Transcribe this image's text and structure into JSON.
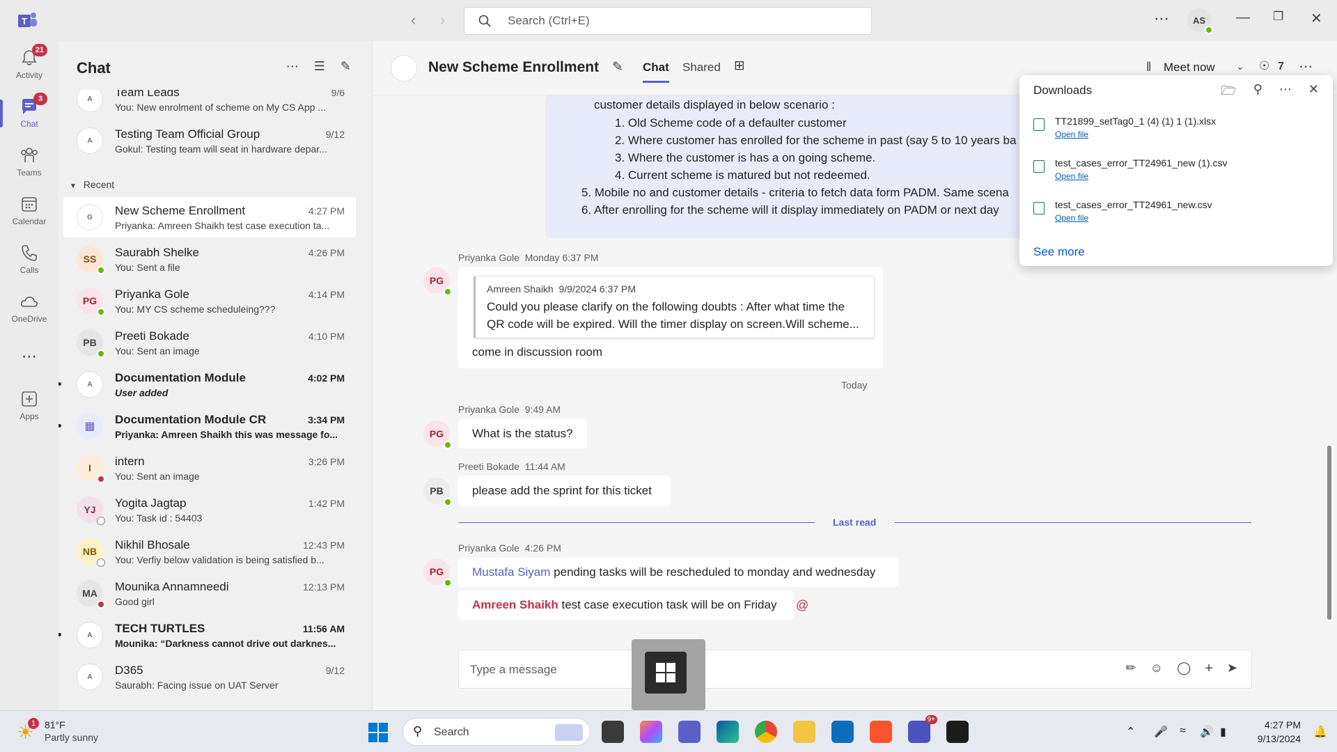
{
  "titlebar": {
    "search_placeholder": "Search (Ctrl+E)",
    "user_initials": "AS"
  },
  "rail": [
    {
      "label": "Activity",
      "badge": "21"
    },
    {
      "label": "Chat",
      "badge": "3"
    },
    {
      "label": "Teams",
      "badge": ""
    },
    {
      "label": "Calendar",
      "badge": ""
    },
    {
      "label": "Calls",
      "badge": ""
    },
    {
      "label": "OneDrive",
      "badge": ""
    },
    {
      "label": "",
      "badge": ""
    },
    {
      "label": "Apps",
      "badge": ""
    }
  ],
  "chatlist": {
    "title": "Chat",
    "section_recent": "Recent",
    "pinned": [
      {
        "name": "Team Leads",
        "time": "9/6",
        "preview": "You: New enrolment of scheme on My CS App ...",
        "avatar": "A"
      },
      {
        "name": "Testing Team Official Group",
        "time": "9/12",
        "preview": "Gokul: Testing team will seat in hardware depar...",
        "avatar": "A"
      }
    ],
    "recent": [
      {
        "name": "New Scheme Enrollment",
        "time": "4:27 PM",
        "preview": "Priyanka: Amreen Shaikh test case execution ta...",
        "avatar": "G",
        "state": "selected"
      },
      {
        "name": "Saurabh Shelke",
        "time": "4:26 PM",
        "preview": "You: Sent a file",
        "avatar": "SS",
        "presence": "online"
      },
      {
        "name": "Priyanka Gole",
        "time": "4:14 PM",
        "preview": "You: MY CS scheme scheduleing???",
        "avatar": "PG",
        "presence": "online"
      },
      {
        "name": "Preeti Bokade",
        "time": "4:10 PM",
        "preview": "You: Sent an image",
        "avatar": "PB",
        "presence": "online"
      },
      {
        "name": "Documentation Module",
        "time": "4:02 PM",
        "preview": "User added",
        "avatar": "A",
        "state": "unread"
      },
      {
        "name": "Documentation Module CR",
        "time": "3:34 PM",
        "preview": "Priyanka: Amreen Shaikh this was message fo...",
        "avatar": "",
        "state": "unread"
      },
      {
        "name": "intern",
        "time": "3:26 PM",
        "preview": "You: Sent an image",
        "avatar": "I",
        "presence": "busy"
      },
      {
        "name": "Yogita Jagtap",
        "time": "1:42 PM",
        "preview": "You: Task id : 54403",
        "avatar": "YJ",
        "presence": "off"
      },
      {
        "name": "Nikhil Bhosale",
        "time": "12:43 PM",
        "preview": "You: Verfiy below validation is being satisfied b...",
        "avatar": "NB",
        "presence": "off"
      },
      {
        "name": "Mounika Annamneedi",
        "time": "12:13 PM",
        "preview": "Good girl",
        "avatar": "MA",
        "presence": "busy"
      },
      {
        "name": "TECH TURTLES",
        "time": "11:56 AM",
        "preview": "Mounika: “Darkness cannot drive out darknes...",
        "avatar": "A",
        "state": "unread"
      },
      {
        "name": "D365",
        "time": "9/12",
        "preview": "Saurabh: Facing issue on UAT Server",
        "avatar": "A"
      }
    ]
  },
  "conversation": {
    "title": "New Scheme Enrollment",
    "tabs": [
      "Chat",
      "Shared"
    ],
    "meet_label": "Meet now",
    "participants": "7",
    "own_message_lines": [
      "customer details displayed in below scenario :",
      "1. Old Scheme code of a defaulter customer",
      "2. Where customer has enrolled for the scheme in past (say 5 to 10 years ba",
      "3. Where the customer is has a on going scheme.",
      "4. Current scheme is matured but not redeemed.",
      "5. Mobile no and customer details - criteria to fetch data form PADM. Same scena",
      "6. After enrolling for the scheme will it display immediately on PADM or next day"
    ],
    "messages": [
      {
        "sender": "Priyanka Gole",
        "time": "Monday 6:37 PM",
        "avatar": "PG",
        "quote_author": "Amreen Shaikh",
        "quote_time": "9/9/2024 6:37 PM",
        "quote_line1": "Could you please clarify on the following doubts : After what time the",
        "quote_line2": "QR code will be expired. Will the timer display on screen.Will scheme...",
        "text": "come in discussion room"
      },
      {
        "sender": "Priyanka Gole",
        "time": "9:49 AM",
        "avatar": "PG",
        "text": "What is the status?"
      },
      {
        "sender": "Preeti Bokade",
        "time": "11:44 AM",
        "avatar": "PB",
        "text": "please add the sprint for this ticket"
      },
      {
        "sender": "Priyanka Gole",
        "time": "4:26 PM",
        "avatar": "PG",
        "mention1": "Mustafa Siyam",
        "text1": " pending tasks will be rescheduled to monday and wednesday",
        "mention2": "Amreen Shaikh",
        "text2": " test case execution task will be on Friday"
      }
    ],
    "day_label": "Today",
    "last_read_label": "Last read",
    "composer_placeholder": "Type a message"
  },
  "downloads": {
    "title": "Downloads",
    "items": [
      {
        "name": "TT21899_setTag0_1 (4) (1) 1 (1).xlsx",
        "action": "Open file"
      },
      {
        "name": "test_cases_error_TT24961_new (1).csv",
        "action": "Open file"
      },
      {
        "name": "test_cases_error_TT24961_new.csv",
        "action": "Open file"
      }
    ],
    "see_more": "See more"
  },
  "taskbar": {
    "weather_badge": "1",
    "temperature": "81°F",
    "condition": "Partly sunny",
    "search_label": "Search",
    "teams_badge": "9+",
    "time": "4:27 PM",
    "date": "9/13/2024"
  },
  "colors": {
    "accent": "#5b5fc7",
    "urgent": "#c4314b",
    "online": "#6bb700"
  }
}
